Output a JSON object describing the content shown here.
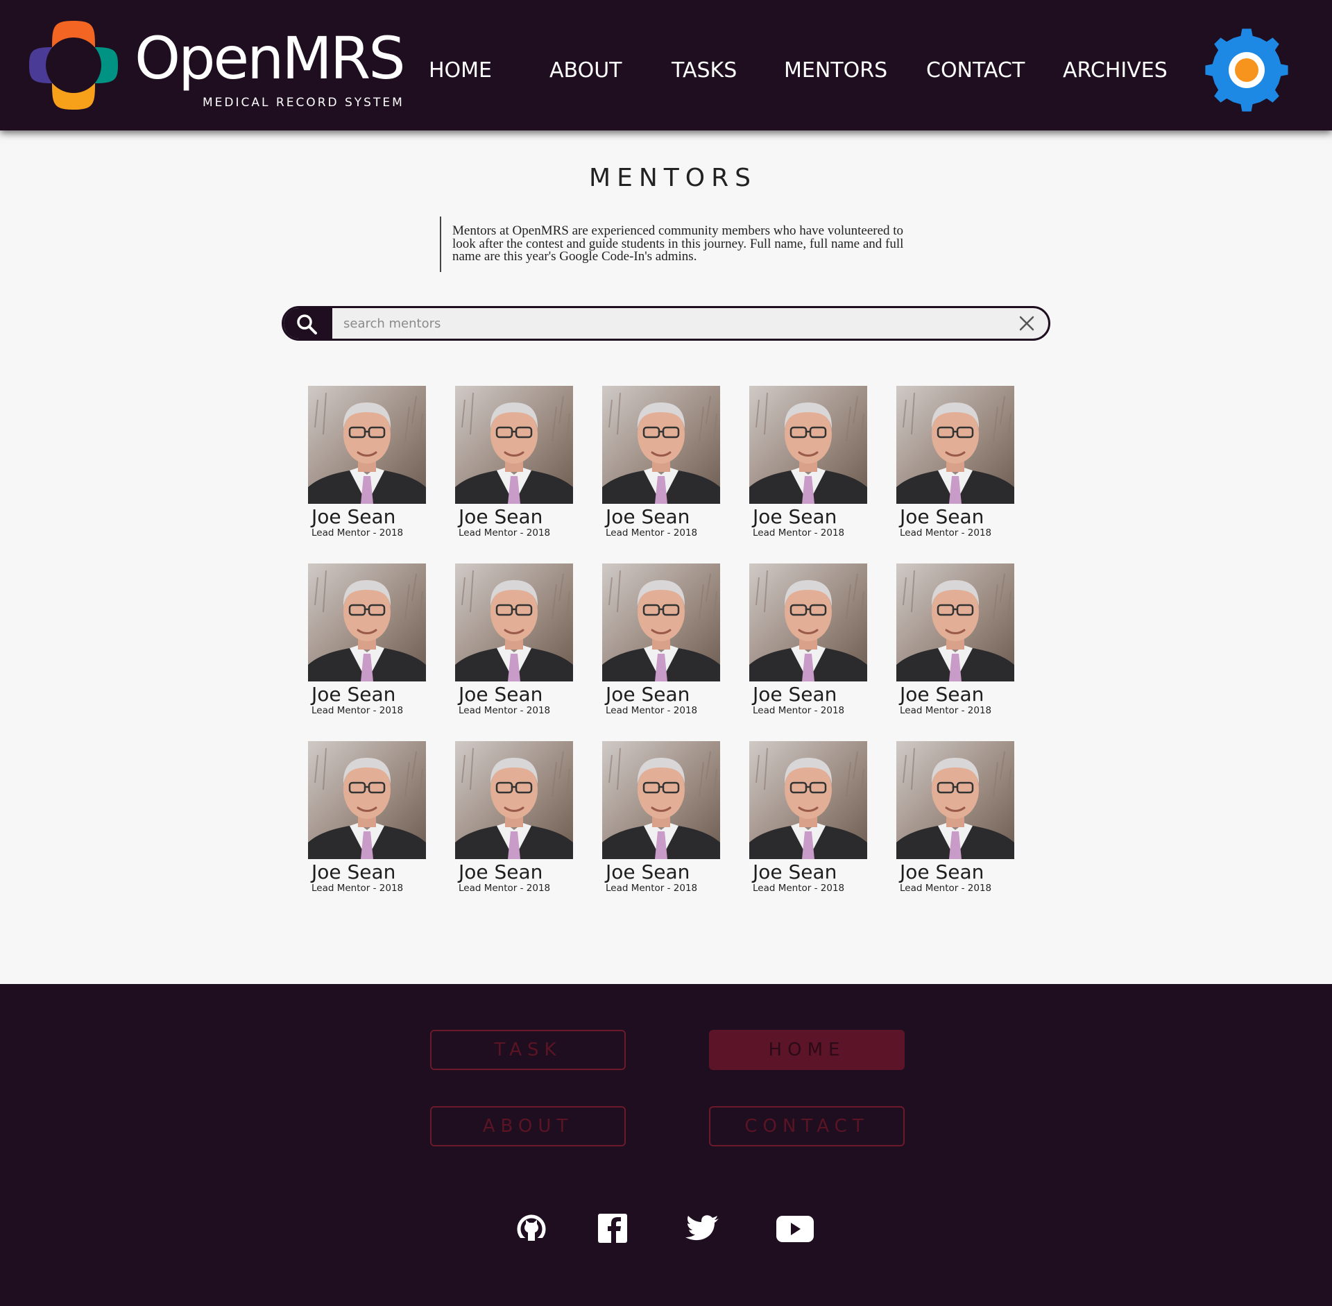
{
  "brand": {
    "name": "OpenMRS",
    "tagline": "MEDICAL RECORD SYSTEM",
    "logo_colors": {
      "top": "#f26522",
      "left": "#4a3c96",
      "right": "#009384",
      "bottom": "#f7a11a"
    }
  },
  "nav": {
    "items": [
      {
        "label": "HOME"
      },
      {
        "label": "ABOUT"
      },
      {
        "label": "TASKS"
      },
      {
        "label": "MENTORS"
      },
      {
        "label": "CONTACT"
      },
      {
        "label": "ARCHIVES"
      }
    ],
    "settings_icon": "gear-icon"
  },
  "page": {
    "title": "MENTORS",
    "intro": "Mentors at OpenMRS are experienced community members who have volunteered to look after the contest and guide students in this journey. Full name, full name and full name are this year's Google Code-In's admins."
  },
  "search": {
    "placeholder": "search mentors",
    "value": "",
    "search_icon": "search-icon",
    "clear_icon": "close-icon"
  },
  "mentors": [
    {
      "name": "Joe Sean",
      "role": "Lead Mentor - 2018"
    },
    {
      "name": "Joe Sean",
      "role": "Lead Mentor - 2018"
    },
    {
      "name": "Joe Sean",
      "role": "Lead Mentor - 2018"
    },
    {
      "name": "Joe Sean",
      "role": "Lead Mentor - 2018"
    },
    {
      "name": "Joe Sean",
      "role": "Lead Mentor - 2018"
    },
    {
      "name": "Joe Sean",
      "role": "Lead Mentor - 2018"
    },
    {
      "name": "Joe Sean",
      "role": "Lead Mentor - 2018"
    },
    {
      "name": "Joe Sean",
      "role": "Lead Mentor - 2018"
    },
    {
      "name": "Joe Sean",
      "role": "Lead Mentor - 2018"
    },
    {
      "name": "Joe Sean",
      "role": "Lead Mentor - 2018"
    },
    {
      "name": "Joe Sean",
      "role": "Lead Mentor - 2018"
    },
    {
      "name": "Joe Sean",
      "role": "Lead Mentor - 2018"
    },
    {
      "name": "Joe Sean",
      "role": "Lead Mentor - 2018"
    },
    {
      "name": "Joe Sean",
      "role": "Lead Mentor - 2018"
    },
    {
      "name": "Joe Sean",
      "role": "Lead Mentor - 2018"
    }
  ],
  "footer": {
    "buttons": [
      {
        "label": "TASK"
      },
      {
        "label": "HOME"
      },
      {
        "label": "ABOUT"
      },
      {
        "label": "CONTACT"
      }
    ],
    "social": [
      "github-icon",
      "facebook-icon",
      "twitter-icon",
      "youtube-icon"
    ]
  },
  "colors": {
    "header_bg": "#1e0e20",
    "footer_bg": "#1e0e20",
    "page_bg": "#f7f7f7",
    "accent_gear": "#1e88e5",
    "accent_gear_center": "#f7941d",
    "footer_button": "#5c1528"
  }
}
